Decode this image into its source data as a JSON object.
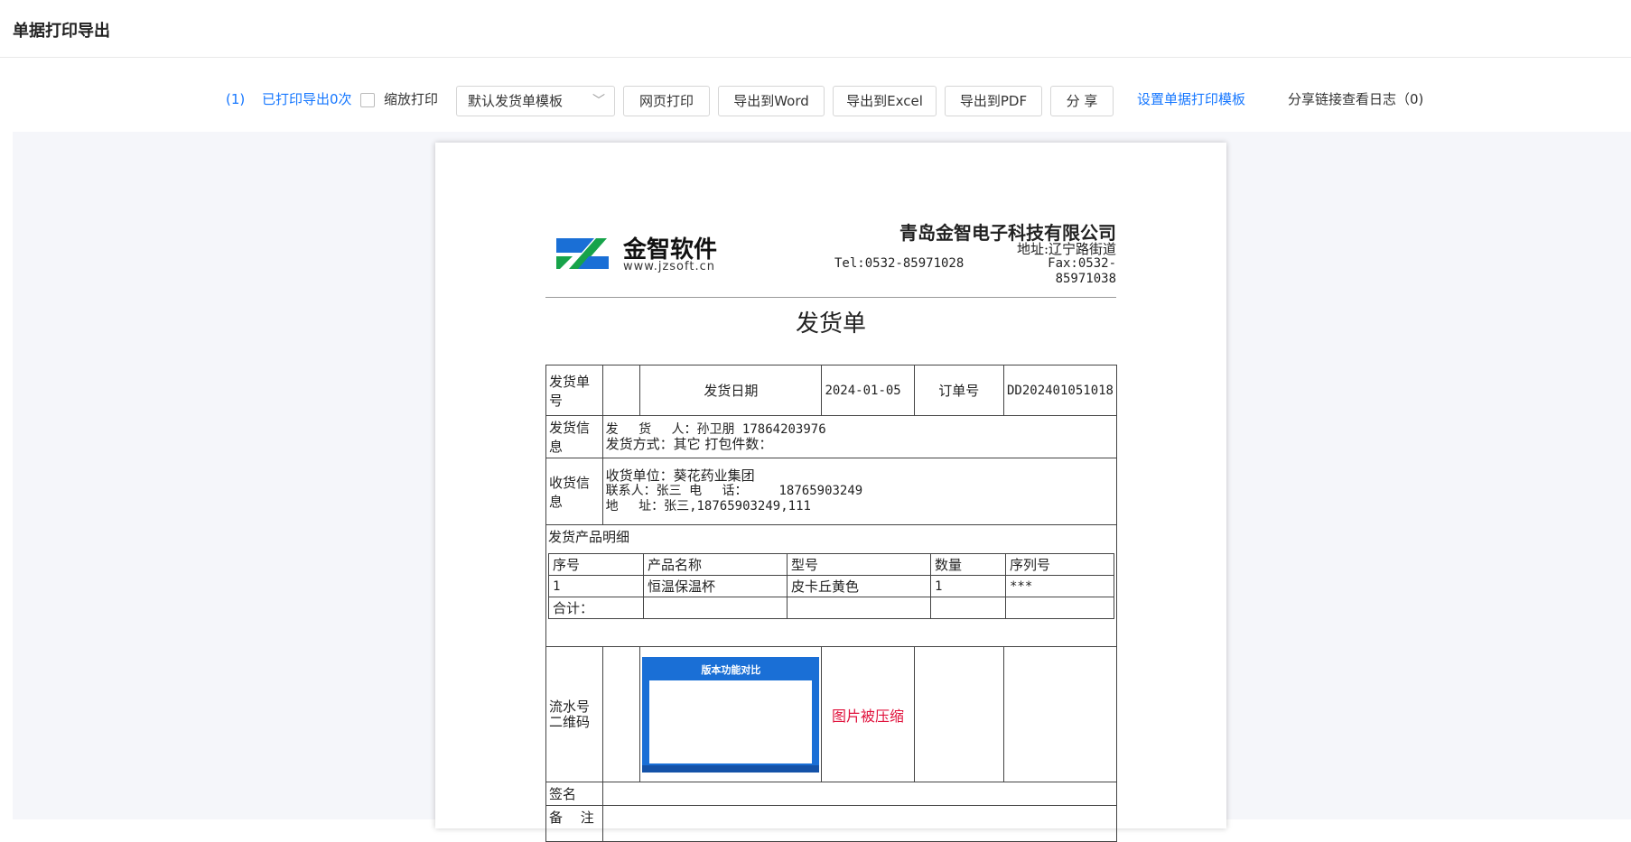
{
  "header": {
    "title": "单据打印导出"
  },
  "toolbar": {
    "index": "(1)",
    "printed_count": "已打印导出0次",
    "zoom_print_label": "缩放打印",
    "template_select": "默认发货单模板",
    "web_print": "网页打印",
    "export_word": "导出到Word",
    "export_excel": "导出到Excel",
    "export_pdf": "导出到PDF",
    "share": "分 享",
    "set_template": "设置单据打印模板",
    "share_log": "分享链接查看日志（0)"
  },
  "document": {
    "logo_text": "金智软件",
    "logo_url": "www.jzsoft.cn",
    "company": "青岛金智电子科技有限公司",
    "address": "地址:辽宁路街道",
    "tel": "Tel:0532-85971028",
    "fax": "Fax:0532-85971038",
    "title": "发货单",
    "row1": {
      "label_no": "发货单号",
      "value_no": "",
      "label_date": "发货日期",
      "value_date": "2024-01-05",
      "label_order": "订单号",
      "value_order": "DD202401051018"
    },
    "ship_info": {
      "label": "发货信息",
      "line1": "发　 货　 人：孙卫朋 17864203976",
      "line2": "发货方式：其它 打包件数："
    },
    "recv_info": {
      "label": "收货信息",
      "line1": "收货单位：葵花药业集团",
      "line2": "联系人：张三 电　 话：　　　18765903249",
      "line3": "地　 址：张三,18765903249,111"
    },
    "products": {
      "label": "发货产品明细",
      "headers": [
        "序号",
        "产品名称",
        "型号",
        "数量",
        "序列号"
      ],
      "rows": [
        [
          "1",
          "恒温保温杯",
          "皮卡丘黄色",
          "1",
          "***"
        ]
      ],
      "total_label": "合计："
    },
    "qr": {
      "label": "流水号二维码",
      "thumb_title": "版本功能对比",
      "compressed_note": "图片被压缩"
    },
    "sign_label": "签名",
    "remark_label": "备　 注"
  }
}
